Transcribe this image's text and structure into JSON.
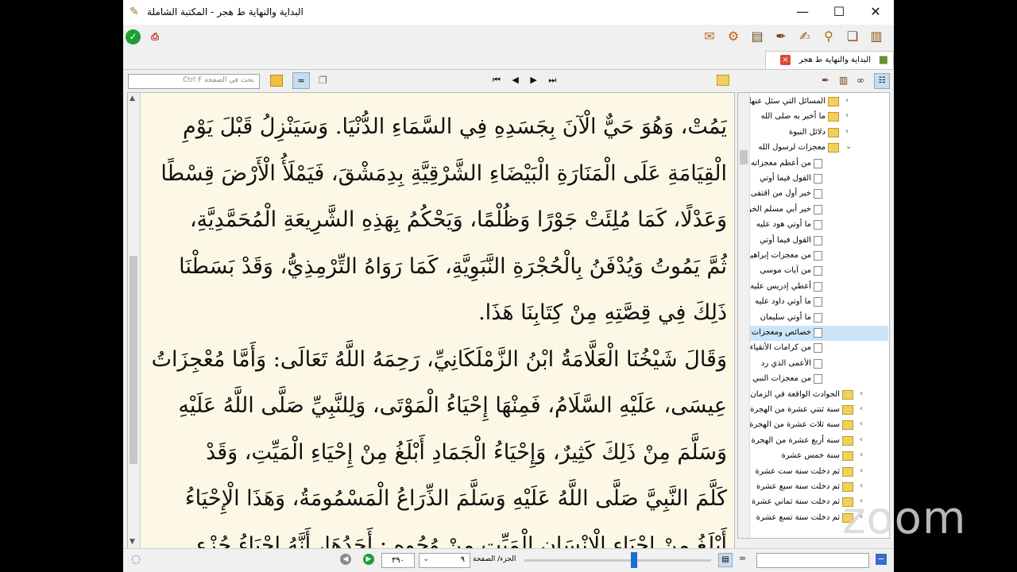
{
  "window": {
    "title": "البداية والنهاية ط هجر - المكتبة الشاملة",
    "minimize": "—",
    "maximize": "☐",
    "close": "✕"
  },
  "tab": {
    "label": "البداية والنهاية ط هجر"
  },
  "search": {
    "placeholder": "بحث في الصفحة  Ctrl F"
  },
  "nav": {
    "first": "⏮",
    "prev": "◀",
    "next": "▶",
    "last": "⏭"
  },
  "page_text": [
    "يَمُتْ، وَهُوَ حَيٌّ الْآنَ بِجَسَدِهِ فِي السَّمَاءِ الدُّنْيَا. وَسَيَنْزِلُ قَبْلَ يَوْمِ",
    "الْقِيَامَةِ عَلَى الْمَنَارَةِ الْبَيْضَاءِ الشَّرْقِيَّةِ بِدِمَشْقَ، فَيَمْلَأُ الْأَرْضَ قِسْطًا",
    "وَعَدْلًا، كَمَا مُلِئَتْ جَوْرًا وَظُلْمًا، وَيَحْكُمُ بِهَذِهِ الشَّرِيعَةِ الْمُحَمَّدِيَّةِ،",
    "ثُمَّ يَمُوتُ وَيُدْفَنُ بِالْحُجْرَةِ النَّبَوِيَّةِ، كَمَا رَوَاهُ التِّرْمِذِيُّ، وَقَدْ بَسَطْنَا",
    "ذَلِكَ فِي قِصَّتِهِ مِنْ كِتَابِنَا هَذَا.",
    "وَقَالَ شَيْخُنَا الْعَلَّامَةُ ابْنُ الزَّمْلَكَانِيِّ، رَحِمَهُ اللَّهُ تَعَالَى: وَأَمَّا مُعْجِزَاتُ",
    "عِيسَى، عَلَيْهِ السَّلَامُ، فَمِنْهَا إِحْيَاءُ الْمَوْتَى، وَلِلنَّبِيِّ صَلَّى اللَّهُ عَلَيْهِ",
    "وَسَلَّمَ مِنْ ذَلِكَ كَثِيرٌ، وَإِحْيَاءُ الْجَمَادِ أَبْلَغُ مِنْ إِحْيَاءِ الْمَيِّتِ، وَقَدْ",
    "كَلَّمَ النَّبِيَّ صَلَّى اللَّهُ عَلَيْهِ وَسَلَّمَ الذِّرَاعُ الْمَسْمُومَةُ، وَهَذَا الْإِحْيَاءُ",
    "أَبْلَغُ مِنْ إِحْيَاءِ الْإِنْسَانِ الْمَيِّتِ مِنْ وُجُوهٍ ; أَحَدُهَا، أَنَّهُ إِحْيَاءُ جُزْءٍ"
  ],
  "tree": [
    {
      "label": "المسائل التي سئل عنها",
      "type": "folder",
      "level": 0,
      "chevron": "›"
    },
    {
      "label": "ما أخبر به صلى الله",
      "type": "folder",
      "level": 0,
      "chevron": "›"
    },
    {
      "label": "دلائل النبوة",
      "type": "folder",
      "level": 0,
      "chevron": "›"
    },
    {
      "label": "معجزات لرسول الله",
      "type": "folder-open",
      "level": 0,
      "chevron": "⌄"
    },
    {
      "label": "من أعظم معجزاته",
      "type": "doc",
      "level": 1
    },
    {
      "label": "القول فيما أوتي",
      "type": "doc",
      "level": 1
    },
    {
      "label": "خبر أول من اقتفى",
      "type": "doc",
      "level": 1
    },
    {
      "label": "خبر أبي مسلم الخولاني",
      "type": "doc",
      "level": 1
    },
    {
      "label": "ما أوتي هود عليه",
      "type": "doc",
      "level": 1
    },
    {
      "label": "القول فيما أوتي",
      "type": "doc",
      "level": 1
    },
    {
      "label": "من معجزات إبراهيم",
      "type": "doc",
      "level": 1
    },
    {
      "label": "من آيات موسى",
      "type": "doc",
      "level": 1
    },
    {
      "label": "أعطي إدريس عليه",
      "type": "doc",
      "level": 1
    },
    {
      "label": "ما أوتي داود عليه",
      "type": "doc",
      "level": 1
    },
    {
      "label": "ما أوتي سليمان",
      "type": "doc",
      "level": 1
    },
    {
      "label": "خصائص ومعجزات",
      "type": "doc",
      "level": 1,
      "selected": true
    },
    {
      "label": "من كرامات الأتقياء",
      "type": "doc",
      "level": 1
    },
    {
      "label": "الأعمى الذي رد",
      "type": "doc",
      "level": 1
    },
    {
      "label": "من معجزات النبي",
      "type": "doc",
      "level": 1
    },
    {
      "label": "الحوادث الواقعة في الزمان",
      "type": "folder",
      "level": -1,
      "chevron": "›"
    },
    {
      "label": "سنة ثنتي عشرة من الهجرة",
      "type": "folder",
      "level": -1,
      "chevron": "›"
    },
    {
      "label": "سنة ثلاث عشرة من الهجرة",
      "type": "folder",
      "level": -1,
      "chevron": "›"
    },
    {
      "label": "سنة أربع عشرة من الهجرة",
      "type": "folder",
      "level": -1,
      "chevron": "›"
    },
    {
      "label": "سنة خمس عشرة",
      "type": "folder",
      "level": -1,
      "chevron": "›"
    },
    {
      "label": "ثم دخلت سنة ست عشرة",
      "type": "folder",
      "level": -1,
      "chevron": "›"
    },
    {
      "label": "ثم دخلت سنة سبع عشرة",
      "type": "folder",
      "level": -1,
      "chevron": "›"
    },
    {
      "label": "ثم دخلت سنة ثماني عشرة",
      "type": "folder",
      "level": -1,
      "chevron": "›"
    },
    {
      "label": "ثم دخلت سنة تسع عشرة",
      "type": "folder",
      "level": -1,
      "chevron": "›"
    }
  ],
  "bottom": {
    "page": "٣٩٠",
    "volume": "٩",
    "page_label": "الجزء/ الصفحة",
    "slider_position": 0.57
  },
  "watermark": "zoom"
}
